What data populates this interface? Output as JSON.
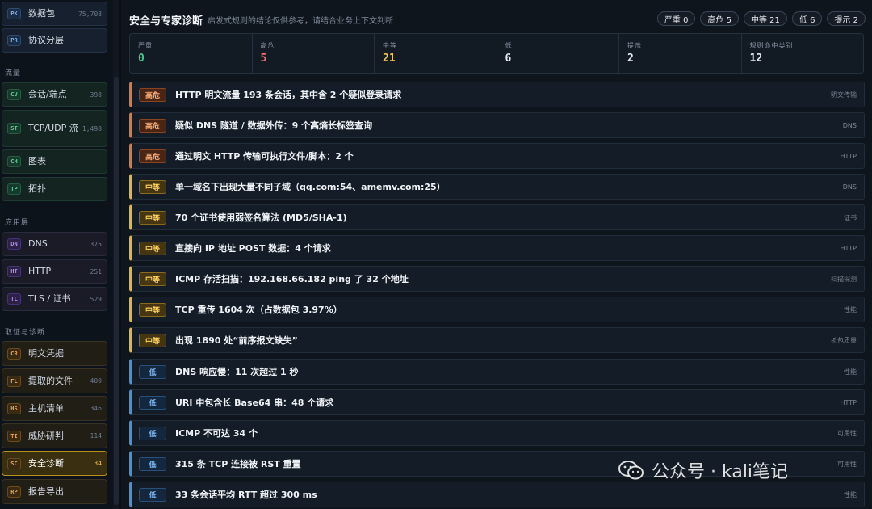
{
  "sidebar": {
    "items_top": [
      {
        "code": "PK",
        "label": "数据包",
        "count": "75,708"
      },
      {
        "code": "PR",
        "label": "协议分层",
        "count": ""
      }
    ],
    "section_flow": "流量",
    "items_flow": [
      {
        "code": "CV",
        "label": "会话/端点",
        "count": "398"
      },
      {
        "code": "ST",
        "label": "TCP/UDP 流",
        "count": "1,498"
      },
      {
        "code": "CH",
        "label": "图表",
        "count": ""
      },
      {
        "code": "TP",
        "label": "拓扑",
        "count": ""
      }
    ],
    "section_app": "应用层",
    "items_app": [
      {
        "code": "DN",
        "label": "DNS",
        "count": "375"
      },
      {
        "code": "HT",
        "label": "HTTP",
        "count": "251"
      },
      {
        "code": "TL",
        "label": "TLS / 证书",
        "count": "529"
      }
    ],
    "section_forensics": "取证与诊断",
    "items_forensics": [
      {
        "code": "CR",
        "label": "明文凭据",
        "count": ""
      },
      {
        "code": "FL",
        "label": "提取的文件",
        "count": "400"
      },
      {
        "code": "HS",
        "label": "主机清单",
        "count": "346"
      },
      {
        "code": "TI",
        "label": "威胁研判",
        "count": "114"
      },
      {
        "code": "SC",
        "label": "安全诊断",
        "count": "34"
      },
      {
        "code": "RP",
        "label": "报告导出",
        "count": ""
      }
    ]
  },
  "header": {
    "title": "安全与专家诊断",
    "subtitle": "启发式规则的结论仅供参考，请结合业务上下文判断",
    "chips": [
      "严重 0",
      "高危 5",
      "中等 21",
      "低 6",
      "提示 2"
    ]
  },
  "stats": [
    {
      "label": "严重",
      "value": "0",
      "color": "#3ccf8e"
    },
    {
      "label": "高危",
      "value": "5",
      "color": "#ff6b6b"
    },
    {
      "label": "中等",
      "value": "21",
      "color": "#f3c94c"
    },
    {
      "label": "低",
      "value": "6",
      "color": "#e6eaf0"
    },
    {
      "label": "提示",
      "value": "2",
      "color": "#e6eaf0"
    },
    {
      "label": "规则命中类别",
      "value": "12",
      "color": "#e6eaf0"
    }
  ],
  "findings": [
    {
      "severity": "high",
      "sev_label": "高危",
      "title": "HTTP 明文流量 193 条会话，其中含 2 个疑似登录请求",
      "category": "明文传输"
    },
    {
      "severity": "high",
      "sev_label": "高危",
      "title": "疑似 DNS 隧道 / 数据外传：9 个高熵长标签查询",
      "category": "DNS"
    },
    {
      "severity": "high",
      "sev_label": "高危",
      "title": "通过明文 HTTP 传输可执行文件/脚本：2 个",
      "category": "HTTP"
    },
    {
      "severity": "med",
      "sev_label": "中等",
      "title": "单一域名下出现大量不同子域（qq.com:54、amemv.com:25）",
      "category": "DNS"
    },
    {
      "severity": "med",
      "sev_label": "中等",
      "title": "70 个证书使用弱签名算法 (MD5/SHA-1)",
      "category": "证书"
    },
    {
      "severity": "med",
      "sev_label": "中等",
      "title": "直接向 IP 地址 POST 数据：4 个请求",
      "category": "HTTP"
    },
    {
      "severity": "med",
      "sev_label": "中等",
      "title": "ICMP 存活扫描：192.168.66.182 ping 了 32 个地址",
      "category": "扫描探测"
    },
    {
      "severity": "med",
      "sev_label": "中等",
      "title": "TCP 重传 1604 次（占数据包 3.97%）",
      "category": "性能"
    },
    {
      "severity": "med",
      "sev_label": "中等",
      "title": "出现 1890 处“前序报文缺失”",
      "category": "抓包质量"
    },
    {
      "severity": "low",
      "sev_label": "低",
      "title": "DNS 响应慢：11 次超过 1 秒",
      "category": "性能"
    },
    {
      "severity": "low",
      "sev_label": "低",
      "title": "URI 中包含长 Base64 串：48 个请求",
      "category": "HTTP"
    },
    {
      "severity": "low",
      "sev_label": "低",
      "title": "ICMP 不可达 34 个",
      "category": "可用性"
    },
    {
      "severity": "low",
      "sev_label": "低",
      "title": "315 条 TCP 连接被 RST 重置",
      "category": "可用性"
    },
    {
      "severity": "low",
      "sev_label": "低",
      "title": "33 条会话平均 RTT 超过 300 ms",
      "category": "性能"
    }
  ],
  "watermark": {
    "text": "公众号 · kali笔记",
    "icon": "wechat-icon"
  }
}
